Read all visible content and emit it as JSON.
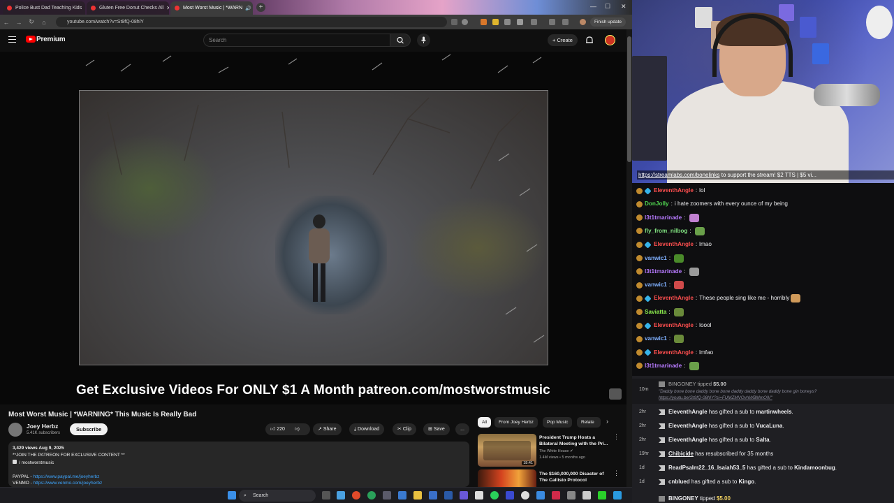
{
  "browser": {
    "tabs": [
      {
        "title": "Police Bust Dad Teaching Kids"
      },
      {
        "title": "Gluten Free Donut Checks All"
      },
      {
        "title": "Most Worst Music | *WARN"
      }
    ],
    "url": "youtube.com/watch?v=St9fQ-08hlY",
    "finish_update": "Finish update"
  },
  "masthead": {
    "brand": "Premium",
    "search_placeholder": "Search",
    "create_label": "Create"
  },
  "video": {
    "banner": "Get Exclusive Videos For ONLY $1 A Month   patreon.com/mostworstmusic",
    "title": "Most Worst Music | *WARNING* This Music Is Really Bad",
    "channel": "Joey Herbz",
    "subscribers": "5.41K subscribers",
    "subscribe_label": "Subscribe",
    "likes": "220",
    "share_label": "Share",
    "download_label": "Download",
    "clip_label": "Clip",
    "save_label": "Save",
    "more_label": "...",
    "description": {
      "stats": "3,429 views  Aug 9, 2025",
      "line1": "**JOIN THE PATREON FOR EXCLUSIVE CONTENT **",
      "line2": "/ mostworstmusic",
      "paypal_label": "PAYPAL -",
      "paypal_link": "https://www.paypal.me/joeyherbz",
      "venmo_label": "VENMO -",
      "venmo_link": "https://www.venmo.com/joeyherbz"
    }
  },
  "sidebar": {
    "chips": [
      "All",
      "From Joey Herbz",
      "Pop Music",
      "Relate"
    ],
    "recs": [
      {
        "title": "President Trump Hosts a Bilateral Meeting with the Pri...",
        "channel": "The White House",
        "meta": "1.4M views • 5 months ago",
        "duration": "18:41"
      },
      {
        "title": "The $160,000,000 Disaster of The Callisto Protocol",
        "channel": "",
        "meta": "",
        "duration": ""
      }
    ]
  },
  "stream": {
    "ticker_link": "https://streamlabs.com/bonelinks",
    "ticker_text": " to support the stream! $2 TTS | $5 vi..."
  },
  "chat": [
    {
      "user": "EleventhAngle",
      "color": "#ff4f4f",
      "badge2": true,
      "text": "lol"
    },
    {
      "user": "DonJolly",
      "color": "#4fd34f",
      "badge2": false,
      "text": "i hate zoomers with every ounce of my being"
    },
    {
      "user": "l3t1tmarinade",
      "color": "#b77aff",
      "badge2": false,
      "text": ""
    },
    {
      "user": "fly_from_nilbog",
      "color": "#7fe07f",
      "badge2": false,
      "text": ""
    },
    {
      "user": "EleventhAngle",
      "color": "#ff4f4f",
      "badge2": true,
      "text": "lmao"
    },
    {
      "user": "vanwic1",
      "color": "#7fb0ff",
      "badge2": false,
      "text": ""
    },
    {
      "user": "l3t1tmarinade",
      "color": "#b77aff",
      "badge2": false,
      "text": ""
    },
    {
      "user": "vanwic1",
      "color": "#7fb0ff",
      "badge2": false,
      "text": ""
    },
    {
      "user": "EleventhAngle",
      "color": "#ff4f4f",
      "badge2": true,
      "text": "These people sing like me - horribly"
    },
    {
      "user": "Saviatta",
      "color": "#8ff04f",
      "badge2": false,
      "text": ""
    },
    {
      "user": "EleventhAngle",
      "color": "#ff4f4f",
      "badge2": true,
      "text": "loool"
    },
    {
      "user": "vanwic1",
      "color": "#7fb0ff",
      "badge2": false,
      "text": ""
    },
    {
      "user": "EleventhAngle",
      "color": "#ff4f4f",
      "badge2": true,
      "text": "lmfao"
    },
    {
      "user": "l3t1tmarinade",
      "color": "#b77aff",
      "badge2": false,
      "text": ""
    }
  ],
  "events": {
    "tip": {
      "time": "10m",
      "user": "BINGONEY",
      "action": "tipped",
      "amount": "$5.00",
      "message": "\"Daddy bone bone daddy bone bone daddy daddy bone daddy bone gin boneys?",
      "link": "https://youtu.be/St9fQ-08hlY?si=FUMZMVOvhWBMmOlV\""
    },
    "items": [
      {
        "time": "2hr",
        "user": "EleventhAngle",
        "pre": " has gifted a sub to ",
        "target": "martinwheels",
        "post": "."
      },
      {
        "time": "2hr",
        "user": "EleventhAngle",
        "pre": " has gifted a sub to ",
        "target": "VucaLuna",
        "post": "."
      },
      {
        "time": "2hr",
        "user": "EleventhAngle",
        "pre": " has gifted a sub to ",
        "target": "Salta",
        "post": "."
      },
      {
        "time": "19hr",
        "user": "Chibicide",
        "pre": " has resubscribed for 35 months",
        "target": "",
        "post": ""
      },
      {
        "time": "1d",
        "user": "ReadPsalm22_16_Isaiah53_5",
        "pre": " has gifted a sub to ",
        "target": "Kindamoonbug",
        "post": "."
      },
      {
        "time": "1d",
        "user": "cnblued",
        "pre": " has gifted a sub to ",
        "target": "Kingo",
        "post": "."
      }
    ],
    "last_tip": {
      "user": "BINGONEY",
      "action": "tipped",
      "amount": "$5.00"
    }
  },
  "taskbar": {
    "search_label": "Search"
  }
}
